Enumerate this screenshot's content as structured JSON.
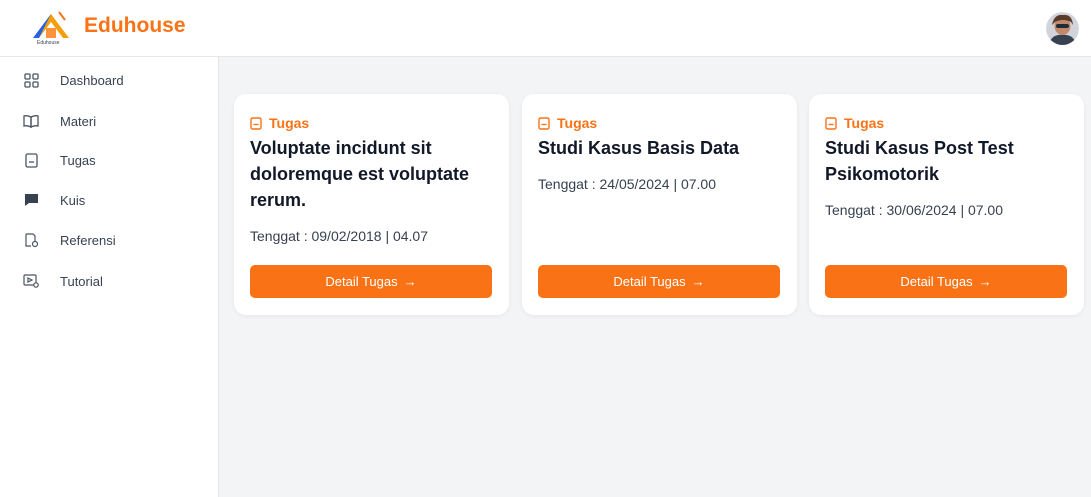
{
  "app": {
    "brand": "Eduhouse",
    "logo_caption": "Eduhouse"
  },
  "sidebar": {
    "items": [
      {
        "label": "Dashboard",
        "icon": "grid-icon"
      },
      {
        "label": "Materi",
        "icon": "book-icon"
      },
      {
        "label": "Tugas",
        "icon": "task-icon"
      },
      {
        "label": "Kuis",
        "icon": "chat-icon"
      },
      {
        "label": "Referensi",
        "icon": "reference-icon"
      },
      {
        "label": "Tutorial",
        "icon": "tutorial-icon"
      }
    ]
  },
  "cards": [
    {
      "tag": "Tugas",
      "title": "Voluptate incidunt sit doloremque est voluptate rerum.",
      "due": "Tenggat : 09/02/2018 | 04.07",
      "button": "Detail Tugas"
    },
    {
      "tag": "Tugas",
      "title": "Studi Kasus Basis Data",
      "due": "Tenggat : 24/05/2024 | 07.00",
      "button": "Detail Tugas"
    },
    {
      "tag": "Tugas",
      "title": "Studi Kasus Post Test Psikomotorik",
      "due": "Tenggat : 30/06/2024 | 07.00",
      "button": "Detail Tugas"
    }
  ],
  "colors": {
    "accent": "#f97316",
    "background": "#f3f4f6"
  }
}
